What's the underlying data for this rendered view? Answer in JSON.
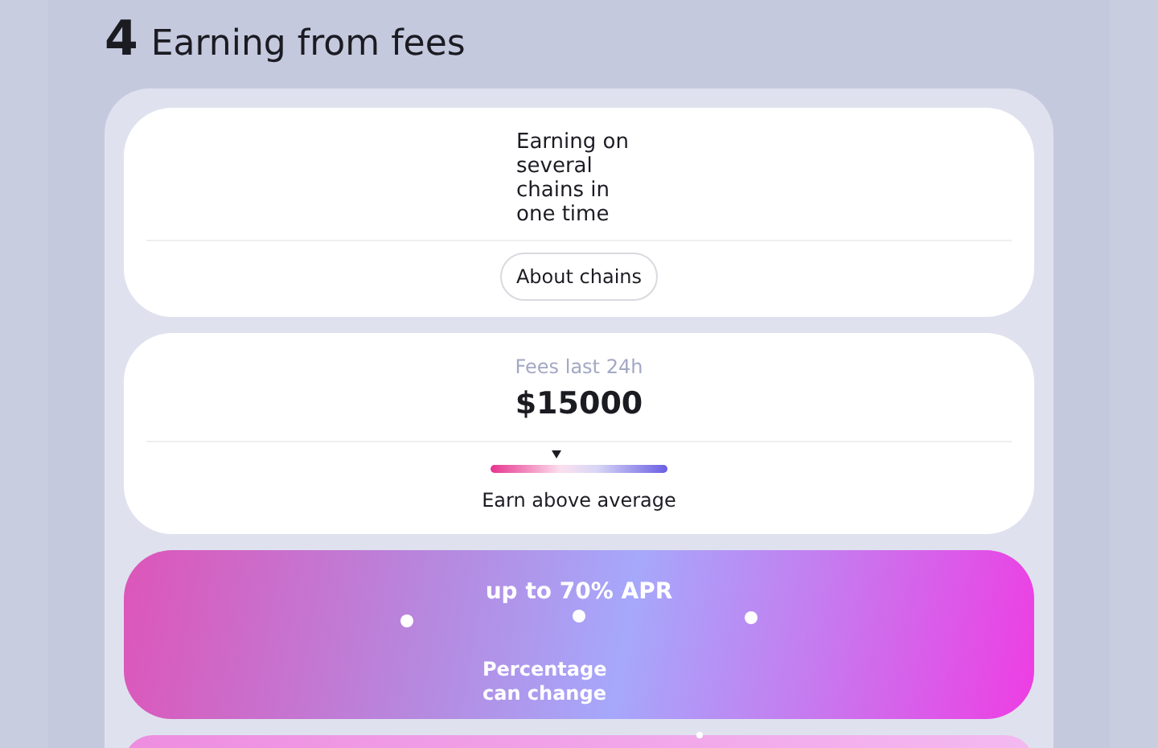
{
  "section": {
    "number": "4",
    "title": "Earning from fees"
  },
  "chains_card": {
    "text": "Earning on several chains in one time",
    "button": "About chains"
  },
  "fees_card": {
    "label": "Fees last 24h",
    "amount": "$15000",
    "meter": {
      "level": 0.37
    },
    "caption": "Earn above average"
  },
  "apr_card": {
    "title": "up to 70% APR",
    "note": "Percentage can change"
  }
}
